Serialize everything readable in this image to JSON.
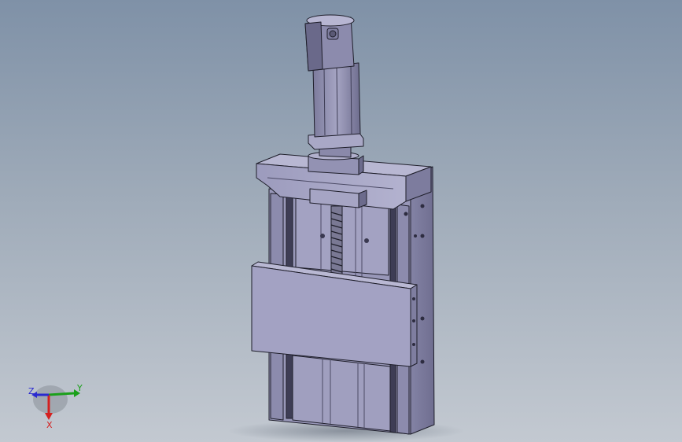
{
  "viewport": {
    "background_top": "#7f91a7",
    "background_bottom": "#c3c9d1",
    "part_fill": "#a7a6c6",
    "part_shade": "#8f8eaf",
    "part_dark": "#5d5c78",
    "edge_color": "#1e1e2a"
  },
  "triad": {
    "x_label": "X",
    "y_label": "Y",
    "z_label": "Z",
    "x_color": "#d42020",
    "y_color": "#1aa01a",
    "z_color": "#2a2ad0"
  }
}
